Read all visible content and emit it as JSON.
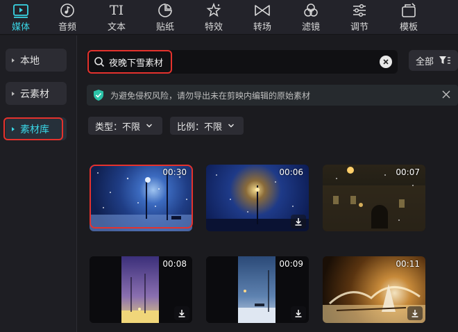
{
  "toolbar": {
    "items": [
      {
        "label": "媒体",
        "icon": "media-icon",
        "active": true
      },
      {
        "label": "音频",
        "icon": "music-note-icon"
      },
      {
        "label": "文本",
        "icon": "text-icon",
        "glyph": "TI"
      },
      {
        "label": "贴纸",
        "icon": "sticker-icon"
      },
      {
        "label": "特效",
        "icon": "star-effect-icon"
      },
      {
        "label": "转场",
        "icon": "transition-icon"
      },
      {
        "label": "滤镜",
        "icon": "filter-circles-icon"
      },
      {
        "label": "调节",
        "icon": "adjust-sliders-icon"
      },
      {
        "label": "模板",
        "icon": "template-icon"
      }
    ]
  },
  "sidebar": {
    "items": [
      {
        "label": "本地"
      },
      {
        "label": "云素材"
      },
      {
        "label": "素材库",
        "active": true
      }
    ]
  },
  "search": {
    "value": "夜晚下雪素材"
  },
  "filter_all": {
    "label": "全部"
  },
  "notice": {
    "text": "为避免侵权风险，请勿导出未在剪映内编辑的原始素材"
  },
  "filters": {
    "type": {
      "label": "类型：",
      "value": "不限"
    },
    "ratio": {
      "label": "比例：",
      "value": "不限"
    }
  },
  "thumbnails": [
    {
      "duration": "00:30"
    },
    {
      "duration": "00:06"
    },
    {
      "duration": "00:07"
    },
    {
      "duration": "00:08"
    },
    {
      "duration": "00:09"
    },
    {
      "duration": "00:11"
    }
  ],
  "colors": {
    "accent": "#3ad6e6",
    "highlight": "#e5322d",
    "shield": "#2bc3a8"
  }
}
